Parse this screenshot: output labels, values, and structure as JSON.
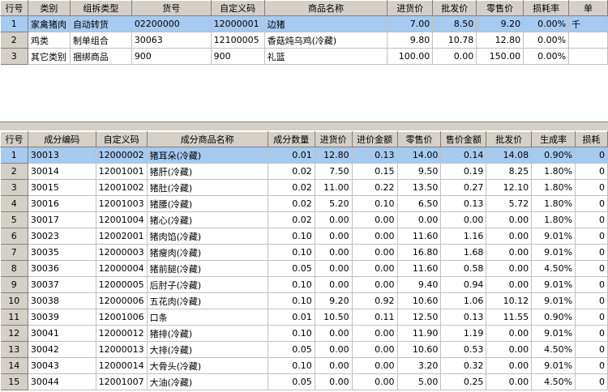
{
  "top_grid": {
    "columns": [
      "行号",
      "类别",
      "组拆类型",
      "货号",
      "自定义码",
      "商品名称",
      "进货价",
      "批发价",
      "零售价",
      "损耗率",
      "单"
    ],
    "rows": [
      {
        "no": "1",
        "category": "家禽猪肉",
        "type": "自动转货",
        "code": "02200000",
        "custom": "12000001",
        "name": "边猪",
        "cost": "7.00",
        "wholesale": "8.50",
        "retail": "9.20",
        "loss": "0.00%",
        "extra": "千",
        "selected": true
      },
      {
        "no": "2",
        "category": "鸡类",
        "type": "制单组合",
        "code": "30063",
        "custom": "12100005",
        "name": "香菇炖乌鸡(冷藏)",
        "cost": "9.80",
        "wholesale": "10.78",
        "retail": "12.80",
        "loss": "0.00%",
        "extra": "",
        "selected": false
      },
      {
        "no": "3",
        "category": "其它类别",
        "type": "捆绑商品",
        "code": "900",
        "custom": "900",
        "name": "礼篮",
        "cost": "100.00",
        "wholesale": "0.00",
        "retail": "150.00",
        "loss": "0.00%",
        "extra": "",
        "selected": false
      }
    ]
  },
  "bottom_grid": {
    "columns": [
      "行号",
      "成分编码",
      "自定义码",
      "成分商品名称",
      "成分数量",
      "进货价",
      "进价金额",
      "零售价",
      "售价金额",
      "批发价",
      "生成率",
      "损耗"
    ],
    "rows": [
      {
        "no": "1",
        "code": "30013",
        "custom": "12000002",
        "name": "猪耳朵(冷藏)",
        "qty": "0.01",
        "cost": "12.80",
        "cost_amt": "0.13",
        "retail": "14.00",
        "retail_amt": "0.14",
        "wholesale": "14.08",
        "rate": "0.90%",
        "loss": "0",
        "selected": true
      },
      {
        "no": "2",
        "code": "30014",
        "custom": "12001001",
        "name": "猪肝(冷藏)",
        "qty": "0.02",
        "cost": "7.50",
        "cost_amt": "0.15",
        "retail": "9.50",
        "retail_amt": "0.19",
        "wholesale": "8.25",
        "rate": "1.80%",
        "loss": "0",
        "selected": false
      },
      {
        "no": "3",
        "code": "30015",
        "custom": "12001002",
        "name": "猪肚(冷藏)",
        "qty": "0.02",
        "cost": "11.00",
        "cost_amt": "0.22",
        "retail": "13.50",
        "retail_amt": "0.27",
        "wholesale": "12.10",
        "rate": "1.80%",
        "loss": "0",
        "selected": false
      },
      {
        "no": "4",
        "code": "30016",
        "custom": "12001003",
        "name": "猪腰(冷藏)",
        "qty": "0.02",
        "cost": "5.20",
        "cost_amt": "0.10",
        "retail": "6.50",
        "retail_amt": "0.13",
        "wholesale": "5.72",
        "rate": "1.80%",
        "loss": "0",
        "selected": false
      },
      {
        "no": "5",
        "code": "30017",
        "custom": "12001004",
        "name": "猪心(冷藏)",
        "qty": "0.02",
        "cost": "0.00",
        "cost_amt": "0.00",
        "retail": "0.00",
        "retail_amt": "0.00",
        "wholesale": "0.00",
        "rate": "1.80%",
        "loss": "0",
        "selected": false
      },
      {
        "no": "6",
        "code": "30023",
        "custom": "12002001",
        "name": "猪肉馅(冷藏)",
        "qty": "0.10",
        "cost": "0.00",
        "cost_amt": "0.00",
        "retail": "11.60",
        "retail_amt": "1.16",
        "wholesale": "0.00",
        "rate": "9.01%",
        "loss": "0",
        "selected": false
      },
      {
        "no": "7",
        "code": "30035",
        "custom": "12000003",
        "name": "猪瘦肉(冷藏)",
        "qty": "0.10",
        "cost": "0.00",
        "cost_amt": "0.00",
        "retail": "16.80",
        "retail_amt": "1.68",
        "wholesale": "0.00",
        "rate": "9.01%",
        "loss": "0",
        "selected": false
      },
      {
        "no": "8",
        "code": "30036",
        "custom": "12000004",
        "name": "猪前腿(冷藏)",
        "qty": "0.05",
        "cost": "0.00",
        "cost_amt": "0.00",
        "retail": "11.60",
        "retail_amt": "0.58",
        "wholesale": "0.00",
        "rate": "4.50%",
        "loss": "0",
        "selected": false
      },
      {
        "no": "9",
        "code": "30037",
        "custom": "12000005",
        "name": "后肘子(冷藏)",
        "qty": "0.10",
        "cost": "0.00",
        "cost_amt": "0.00",
        "retail": "9.40",
        "retail_amt": "0.94",
        "wholesale": "0.00",
        "rate": "9.01%",
        "loss": "0",
        "selected": false
      },
      {
        "no": "10",
        "code": "30038",
        "custom": "12000006",
        "name": "五花肉(冷藏)",
        "qty": "0.10",
        "cost": "9.20",
        "cost_amt": "0.92",
        "retail": "10.60",
        "retail_amt": "1.06",
        "wholesale": "10.12",
        "rate": "9.01%",
        "loss": "0",
        "selected": false
      },
      {
        "no": "11",
        "code": "30039",
        "custom": "12001006",
        "name": "口条",
        "qty": "0.01",
        "cost": "10.50",
        "cost_amt": "0.11",
        "retail": "12.50",
        "retail_amt": "0.13",
        "wholesale": "11.55",
        "rate": "0.90%",
        "loss": "0",
        "selected": false
      },
      {
        "no": "12",
        "code": "30041",
        "custom": "12000012",
        "name": "猪排(冷藏)",
        "qty": "0.10",
        "cost": "0.00",
        "cost_amt": "0.00",
        "retail": "11.90",
        "retail_amt": "1.19",
        "wholesale": "0.00",
        "rate": "9.01%",
        "loss": "0",
        "selected": false
      },
      {
        "no": "13",
        "code": "30042",
        "custom": "12000013",
        "name": "大排(冷藏)",
        "qty": "0.05",
        "cost": "0.00",
        "cost_amt": "0.00",
        "retail": "10.60",
        "retail_amt": "0.53",
        "wholesale": "0.00",
        "rate": "4.50%",
        "loss": "0",
        "selected": false
      },
      {
        "no": "14",
        "code": "30043",
        "custom": "12000014",
        "name": "大骨头(冷藏)",
        "qty": "0.10",
        "cost": "0.00",
        "cost_amt": "0.00",
        "retail": "3.20",
        "retail_amt": "0.32",
        "wholesale": "0.00",
        "rate": "9.01%",
        "loss": "0",
        "selected": false
      },
      {
        "no": "15",
        "code": "30044",
        "custom": "12001007",
        "name": "大油(冷藏)",
        "qty": "0.05",
        "cost": "0.00",
        "cost_amt": "0.00",
        "retail": "5.00",
        "retail_amt": "0.25",
        "wholesale": "0.00",
        "rate": "4.50%",
        "loss": "0",
        "selected": false
      }
    ]
  },
  "colors": {
    "selected_row": "#a6caf0",
    "grid_face": "#d4d0c8",
    "grid_line": "#c0c0c0"
  }
}
